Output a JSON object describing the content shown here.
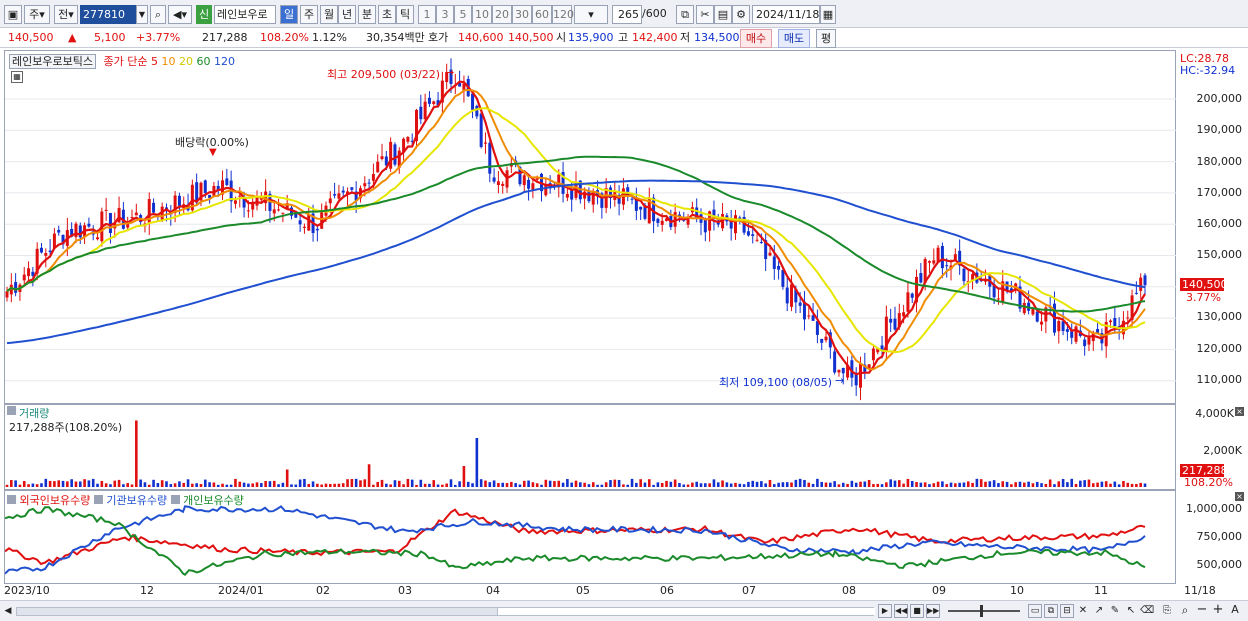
{
  "toolbar": {
    "prefix_primary": "주",
    "prefix_secondary": "전",
    "code": "277810",
    "name": "레인보우로",
    "new_badge": "신",
    "periods": [
      "일",
      "주",
      "월",
      "년",
      "분",
      "초",
      "틱"
    ],
    "intervals": [
      "1",
      "3",
      "5",
      "10",
      "20",
      "30",
      "60",
      "120"
    ],
    "count": "265",
    "count_total": "/600",
    "date": "2024/11/18"
  },
  "quote": {
    "price": "140,500",
    "arrow": "▲",
    "change": "5,100",
    "change_pct": "+3.77%",
    "volume": "217,288",
    "volume_pct": "108.20%",
    "turnover_pct": "1.12%",
    "amount": "30,354백만",
    "bid_label": "호가",
    "bid": "140,600",
    "ask": "140,500",
    "open_label": "시",
    "open": "135,900",
    "high_label": "고",
    "high": "142,400",
    "low_label": "저",
    "low": "134,500",
    "buy_button": "매수",
    "sell_button": "매도",
    "eval_button": "평"
  },
  "legend": {
    "stock_name": "레인보우로보틱스",
    "ma_label": "종가 단순",
    "ma_periods": [
      {
        "p": "5",
        "color": "#e01010"
      },
      {
        "p": "10",
        "color": "#f08c00"
      },
      {
        "p": "20",
        "color": "#e6e600"
      },
      {
        "p": "60",
        "color": "#1a8a2a"
      },
      {
        "p": "120",
        "color": "#2050d0"
      }
    ]
  },
  "annotations": {
    "high": "최고 209,500 (03/22)",
    "low": "최저 109,100 (08/05)",
    "dividend": "배당락(0.00%)",
    "lc": "LC:28.78",
    "hc": "HC:-32.94",
    "price_tag": "140,500",
    "pct_tag": "3.77%",
    "volume_tag": "217,288",
    "volume_pct_tag": "108.20%"
  },
  "price_axis": [
    "200,000",
    "190,000",
    "180,000",
    "170,000",
    "160,000",
    "150,000",
    "140,000",
    "130,000",
    "120,000",
    "110,000"
  ],
  "volume_pane": {
    "title": "거래량",
    "current": "217,288주(108.20%)",
    "axis": [
      "4,000K",
      "2,000K"
    ]
  },
  "holdings_pane": {
    "legend": [
      {
        "name": "외국인보유수량",
        "color": "#e01010"
      },
      {
        "name": "기관보유수량",
        "color": "#2050d0"
      },
      {
        "name": "개인보유수량",
        "color": "#1a8a2a"
      }
    ],
    "axis": [
      "1,000,000",
      "750,000",
      "500,000"
    ]
  },
  "x_axis": [
    "2023/10",
    "12",
    "2024/01",
    "02",
    "03",
    "04",
    "05",
    "06",
    "07",
    "08",
    "09",
    "10",
    "11",
    "11/18"
  ],
  "colors": {
    "up": "#e01010",
    "down": "#1030d0",
    "ma5": "#e01010",
    "ma10": "#f08c00",
    "ma20": "#e6e600",
    "ma60": "#1a8a2a",
    "ma120": "#2050d0"
  },
  "chart_data": {
    "type": "line",
    "price_key_points": [
      {
        "x": "2023/10",
        "y": 138000
      },
      {
        "x": "2023/11",
        "y": 158000
      },
      {
        "x": "2023/12",
        "y": 162000
      },
      {
        "x": "2024/01",
        "y": 172000
      },
      {
        "x": "2024/02",
        "y": 160000
      },
      {
        "x": "2024/03",
        "y": 185000
      },
      {
        "x": "2024/03/22",
        "y": 209500
      },
      {
        "x": "2024/04",
        "y": 178000
      },
      {
        "x": "2024/05",
        "y": 172000
      },
      {
        "x": "2024/06",
        "y": 164000
      },
      {
        "x": "2024/07",
        "y": 158000
      },
      {
        "x": "2024/08/05",
        "y": 109100
      },
      {
        "x": "2024/09",
        "y": 150000
      },
      {
        "x": "2024/10",
        "y": 138000
      },
      {
        "x": "2024/11",
        "y": 121000
      },
      {
        "x": "2024/11/18",
        "y": 140500
      }
    ],
    "ylim": [
      105000,
      212000
    ],
    "series": [
      {
        "name": "외국인보유수량"
      },
      {
        "name": "기관보유수량"
      },
      {
        "name": "개인보유수량"
      }
    ],
    "holdings_ylim": [
      450000,
      1050000
    ]
  }
}
